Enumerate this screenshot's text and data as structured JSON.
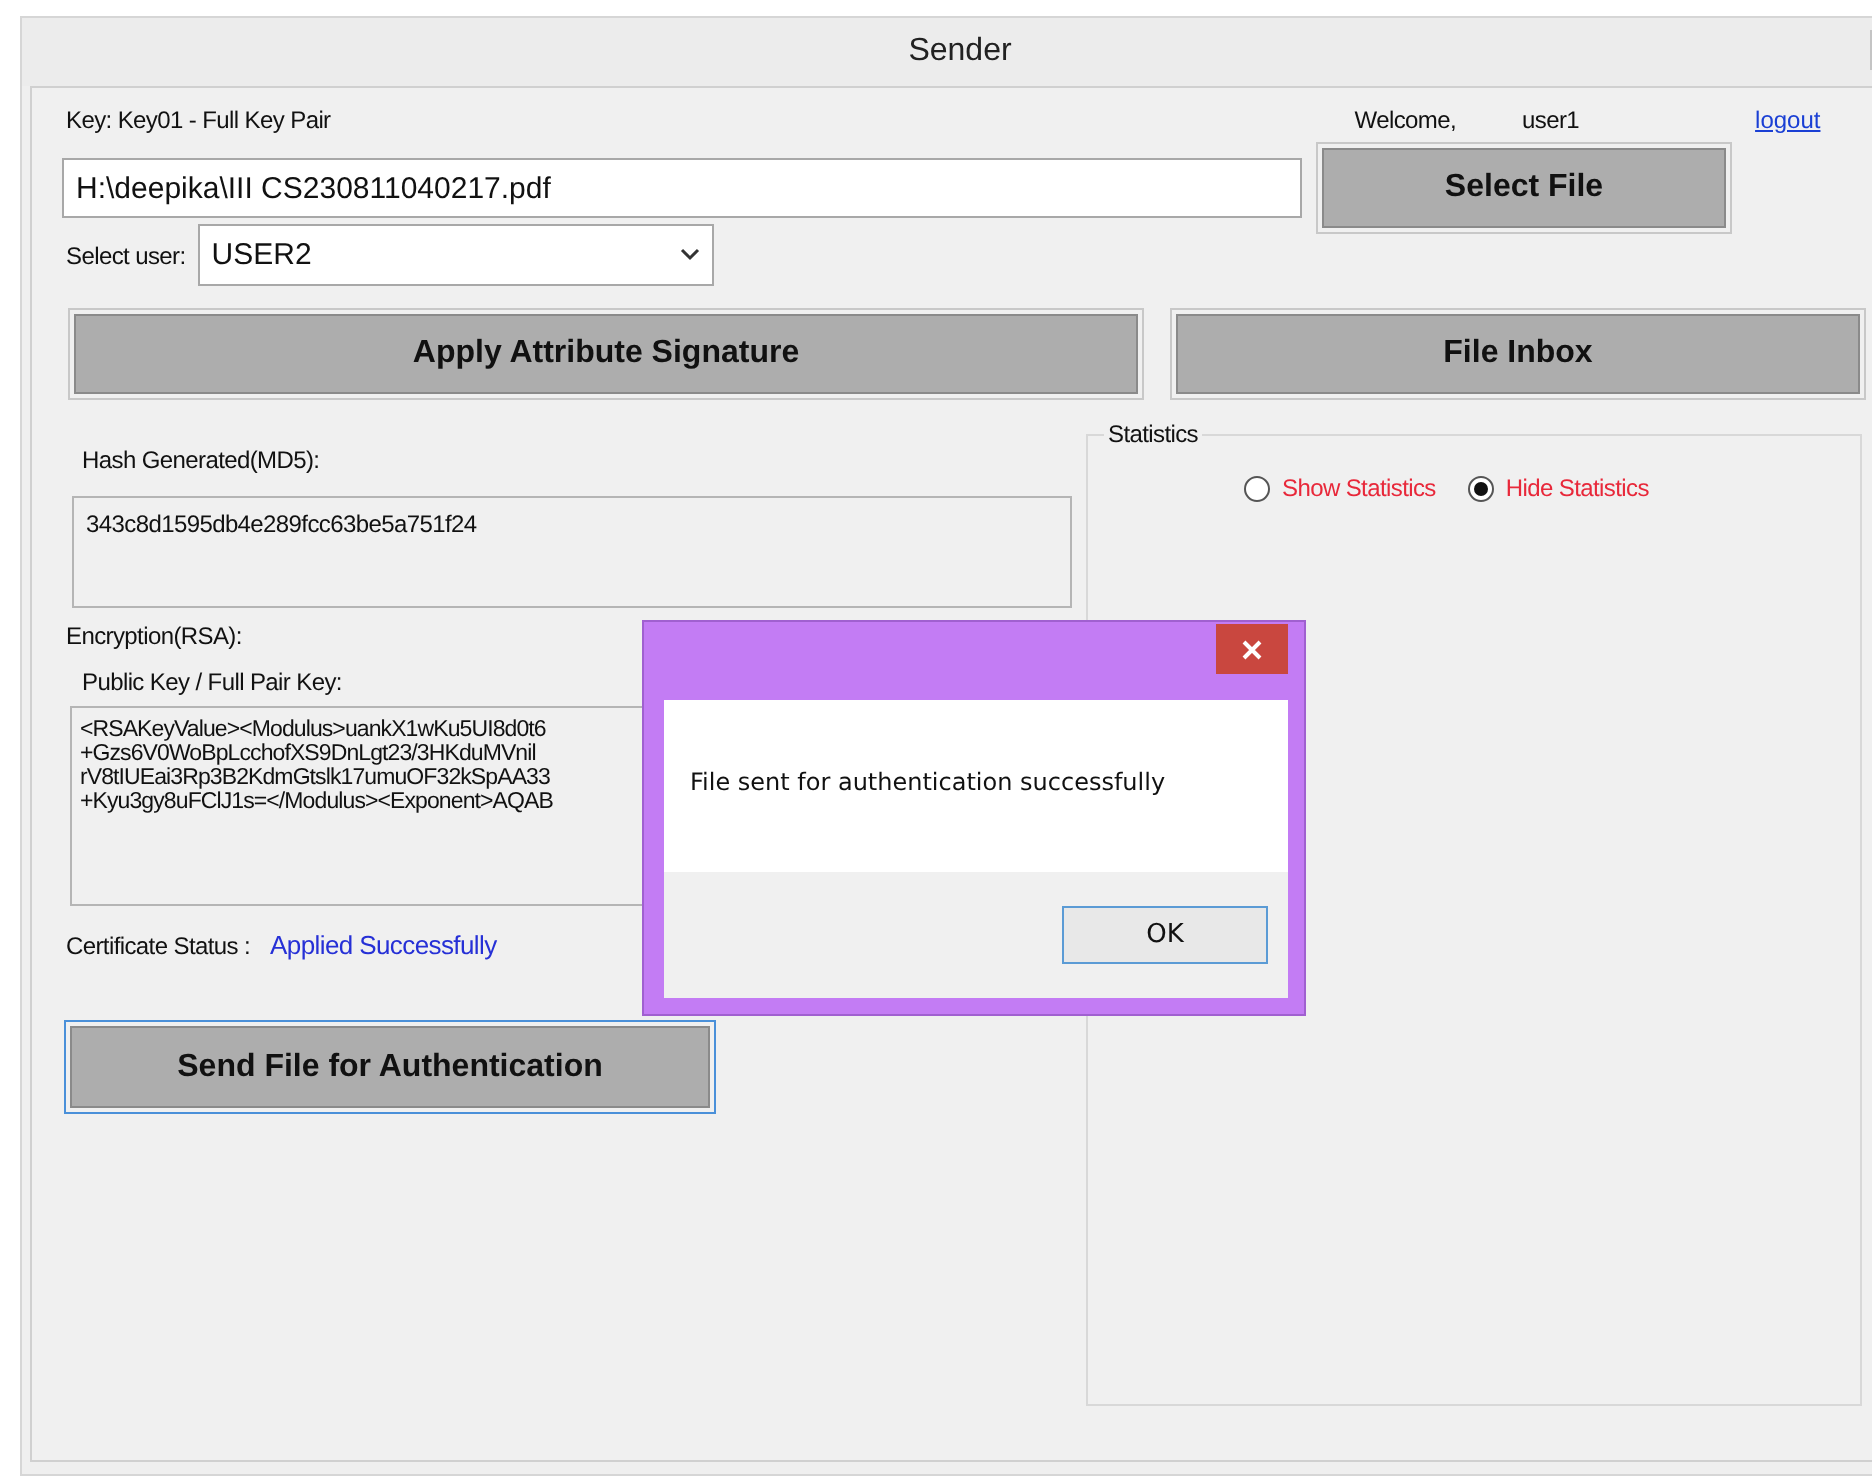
{
  "window": {
    "title": "Sender"
  },
  "header": {
    "key_label": "Key: Key01 - Full Key Pair",
    "welcome": "Welcome,",
    "user": "user1",
    "logout": "logout"
  },
  "file_path": {
    "value": "H:\\deepika\\III CS230811040217.pdf"
  },
  "select_file_button": "Select File",
  "user_select": {
    "label": "Select user:",
    "value": "USER2"
  },
  "apply_button": "Apply Attribute Signature",
  "inbox_button": "File Inbox",
  "hash": {
    "label": "Hash Generated(MD5):",
    "value": "343c8d1595db4e289fcc63be5a751f24"
  },
  "encryption": {
    "label": "Encryption(RSA):",
    "key_label": "Public Key / Full Pair Key:",
    "key_lines": [
      "<RSAKeyValue><Modulus>uankX1wKu5UI8d0t6",
      "+Gzs6V0WoBpLcchofXS9DnLgt23/3HKduMVnil",
      "rV8tIUEai3Rp3B2KdmGtslk17umuOF32kSpAA33",
      "+Kyu3gy8uFClJ1s=</Modulus><Exponent>AQAB"
    ]
  },
  "certificate": {
    "label": "Certificate Status :",
    "value": "Applied Successfully"
  },
  "send_button": "Send File for Authentication",
  "statistics": {
    "title": "Statistics",
    "options": [
      {
        "label": "Show Statistics",
        "selected": false
      },
      {
        "label": "Hide Statistics",
        "selected": true
      }
    ]
  },
  "dialog": {
    "message": "File sent for authentication successfully",
    "ok": "OK"
  }
}
